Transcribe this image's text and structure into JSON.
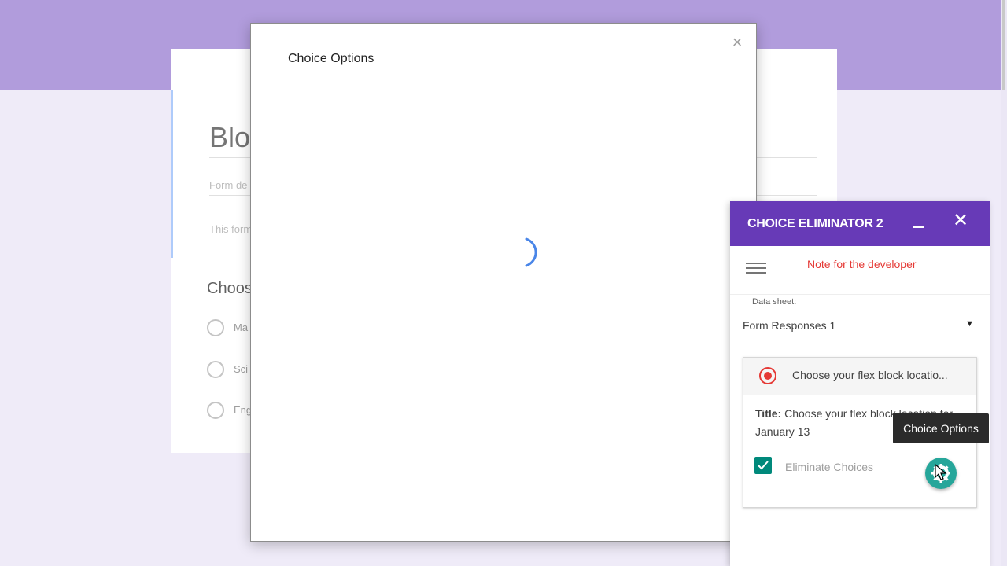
{
  "form": {
    "title_partial": "Blo",
    "description_placeholder_partial": "Form de",
    "note_partial": "This form",
    "question_partial": "Choos",
    "options_partial": [
      "Ma",
      "Sci",
      "Eng"
    ]
  },
  "modal": {
    "title": "Choice Options",
    "close_glyph": "×"
  },
  "sidebar": {
    "title": "CHOICE ELIMINATOR 2",
    "close_glyph": "✕",
    "note_link": "Note for the developer",
    "data_sheet_label": "Data sheet:",
    "data_sheet_value": "Form Responses 1",
    "dropdown_arrow": "▼",
    "question_summary": "Choose your flex block locatio...",
    "question_title_label": "Title:",
    "question_title_value": "Choose your flex block location for January 13",
    "eliminate_label": "Eliminate Choices",
    "eliminate_checked": true,
    "accent_color": "#673ab7",
    "fab_color": "#26a69a"
  },
  "tooltip": {
    "text": "Choice Options"
  }
}
